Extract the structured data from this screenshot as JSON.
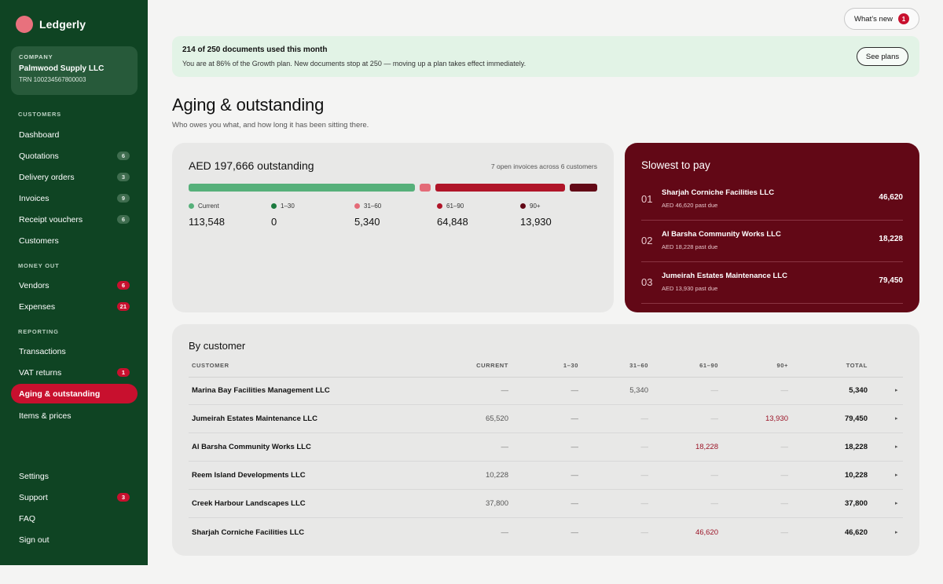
{
  "app": {
    "name": "Ledgerly"
  },
  "company": {
    "label": "COMPANY",
    "name": "Palmwood Supply LLC",
    "trn": "TRN 100234567800003"
  },
  "nav": {
    "sections": [
      {
        "label": "CUSTOMERS"
      },
      {
        "label": "MONEY OUT"
      },
      {
        "label": "REPORTING"
      }
    ],
    "items": [
      {
        "label": "Dashboard",
        "badge": ""
      },
      {
        "label": "Quotations",
        "badge": "6"
      },
      {
        "label": "Delivery orders",
        "badge": "3"
      },
      {
        "label": "Invoices",
        "badge": "9"
      },
      {
        "label": "Receipt vouchers",
        "badge": "6"
      },
      {
        "label": "Customers",
        "badge": ""
      },
      {
        "label": "Vendors",
        "badge": "6"
      },
      {
        "label": "Expenses",
        "badge": "21"
      },
      {
        "label": "Transactions",
        "badge": ""
      },
      {
        "label": "VAT returns",
        "badge": "1"
      },
      {
        "label": "Aging & outstanding",
        "badge": "",
        "active": true
      },
      {
        "label": "Items & prices",
        "badge": ""
      },
      {
        "label": "Settings",
        "badge": ""
      },
      {
        "label": "Support",
        "badge": "3"
      },
      {
        "label": "FAQ",
        "badge": ""
      },
      {
        "label": "Sign out",
        "badge": ""
      }
    ]
  },
  "header": {
    "whats_new": "What’s new",
    "whats_new_count": "1"
  },
  "banner": {
    "title": "214 of 250 documents used this month",
    "text": "You are at 86% of the Growth plan. New documents stop at 250 — moving up a plan takes effect immediately.",
    "button": "See plans",
    "used": 214,
    "limit": 250
  },
  "page": {
    "title": "Aging & outstanding",
    "subtitle": "Who owes you what, and how long it has been sitting there."
  },
  "outstanding": {
    "total": "AED 197,666 outstanding",
    "meta": "7 open invoices across 6 customers",
    "buckets": [
      {
        "label": "Current",
        "value": "113,548",
        "amount": 113548,
        "color": "#56b07a"
      },
      {
        "label": "1–30",
        "value": "0",
        "amount": 0,
        "color": "#1b7a3e"
      },
      {
        "label": "31–60",
        "value": "5,340",
        "amount": 5340,
        "color": "#e46b78"
      },
      {
        "label": "61–90",
        "value": "64,848",
        "amount": 64848,
        "color": "#b01529"
      },
      {
        "label": "90+",
        "value": "13,930",
        "amount": 13930,
        "color": "#620816"
      }
    ]
  },
  "slowest": {
    "title": "Slowest to pay",
    "rows": [
      {
        "rank": "01",
        "name": "Sharjah Corniche Facilities LLC",
        "sub": "AED 46,620 past due",
        "amount": "46,620"
      },
      {
        "rank": "02",
        "name": "Al Barsha Community Works LLC",
        "sub": "AED 18,228 past due",
        "amount": "18,228"
      },
      {
        "rank": "03",
        "name": "Jumeirah Estates Maintenance LLC",
        "sub": "AED 13,930 past due",
        "amount": "79,450"
      }
    ]
  },
  "by_customer": {
    "title": "By customer",
    "columns": [
      "CUSTOMER",
      "CURRENT",
      "1–30",
      "31–60",
      "61–90",
      "90+",
      "TOTAL"
    ],
    "rows": [
      {
        "name": "Marina Bay Facilities Management LLC",
        "current": "—",
        "d1_30": "—",
        "d31_60": "5,340",
        "d61_90": "—",
        "d90": "—",
        "total": "5,340"
      },
      {
        "name": "Jumeirah Estates Maintenance LLC",
        "current": "65,520",
        "d1_30": "—",
        "d31_60": "—",
        "d61_90": "—",
        "d90": "13,930",
        "total": "79,450"
      },
      {
        "name": "Al Barsha Community Works LLC",
        "current": "—",
        "d1_30": "—",
        "d31_60": "—",
        "d61_90": "18,228",
        "d90": "—",
        "total": "18,228"
      },
      {
        "name": "Reem Island Developments LLC",
        "current": "10,228",
        "d1_30": "—",
        "d31_60": "—",
        "d61_90": "—",
        "d90": "—",
        "total": "10,228"
      },
      {
        "name": "Creek Harbour Landscapes LLC",
        "current": "37,800",
        "d1_30": "—",
        "d31_60": "—",
        "d61_90": "—",
        "d90": "—",
        "total": "37,800"
      },
      {
        "name": "Sharjah Corniche Facilities LLC",
        "current": "—",
        "d1_30": "—",
        "d31_60": "—",
        "d61_90": "46,620",
        "d90": "—",
        "total": "46,620"
      }
    ],
    "row_chevron": "▸"
  }
}
